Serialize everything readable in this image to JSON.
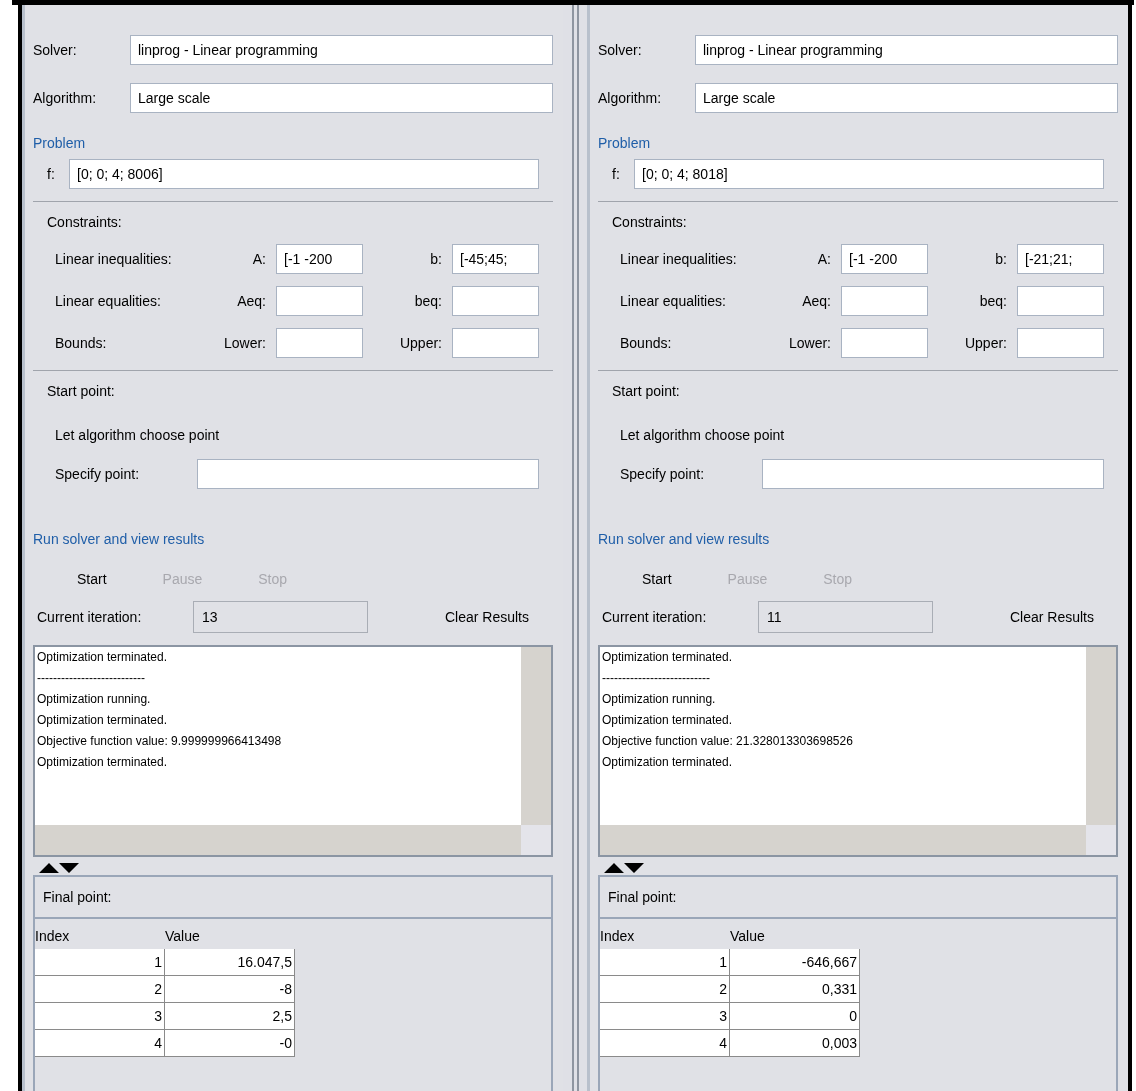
{
  "panels": [
    {
      "solver": {
        "label": "Solver:",
        "value": "linprog - Linear programming"
      },
      "algorithm": {
        "label": "Algorithm:",
        "value": "Large scale"
      },
      "problem_heading": "Problem",
      "f": {
        "label": "f:",
        "value": "[0; 0; 4; 8006]"
      },
      "constraints": {
        "title": "Constraints:",
        "rows": [
          {
            "label": "Linear inequalities:",
            "field_1_label": "A:",
            "field_1_value": "[-1 -200",
            "field_2_label": "b:",
            "field_2_value": "[-45;45;"
          },
          {
            "label": "Linear equalities:",
            "field_1_label": "Aeq:",
            "field_1_value": "",
            "field_2_label": "beq:",
            "field_2_value": ""
          },
          {
            "label": "Bounds:",
            "field_1_label": "Lower:",
            "field_1_value": "",
            "field_2_label": "Upper:",
            "field_2_value": ""
          }
        ]
      },
      "start_point": {
        "title": "Start point:",
        "option": "Let algorithm choose point",
        "specify_label": "Specify point:"
      },
      "run_heading": "Run solver and view results",
      "buttons": [
        {
          "label": "Start",
          "disabled": false
        },
        {
          "label": "Pause",
          "disabled": true
        },
        {
          "label": "Stop",
          "disabled": true
        }
      ],
      "iteration": {
        "label": "Current iteration:",
        "value": "13"
      },
      "clear_button": "Clear Results",
      "log": [
        "Optimization terminated.",
        "---------------------------",
        "Optimization running.",
        "Optimization terminated.",
        "Objective function value: 9.999999966413498",
        "Optimization terminated."
      ],
      "final_point": {
        "title": "Final point:",
        "columns": [
          "Index",
          "Value"
        ],
        "rows": [
          [
            "1",
            "16.047,5"
          ],
          [
            "2",
            "-8"
          ],
          [
            "3",
            "2,5"
          ],
          [
            "4",
            "-0"
          ]
        ]
      }
    },
    {
      "solver": {
        "label": "Solver:",
        "value": "linprog - Linear programming"
      },
      "algorithm": {
        "label": "Algorithm:",
        "value": "Large scale"
      },
      "problem_heading": "Problem",
      "f": {
        "label": "f:",
        "value": "[0; 0; 4; 8018]"
      },
      "constraints": {
        "title": "Constraints:",
        "rows": [
          {
            "label": "Linear inequalities:",
            "field_1_label": "A:",
            "field_1_value": "[-1 -200",
            "field_2_label": "b:",
            "field_2_value": "[-21;21;"
          },
          {
            "label": "Linear equalities:",
            "field_1_label": "Aeq:",
            "field_1_value": "",
            "field_2_label": "beq:",
            "field_2_value": ""
          },
          {
            "label": "Bounds:",
            "field_1_label": "Lower:",
            "field_1_value": "",
            "field_2_label": "Upper:",
            "field_2_value": ""
          }
        ]
      },
      "start_point": {
        "title": "Start point:",
        "option": "Let algorithm choose point",
        "specify_label": "Specify point:"
      },
      "run_heading": "Run solver and view results",
      "buttons": [
        {
          "label": "Start",
          "disabled": false
        },
        {
          "label": "Pause",
          "disabled": true
        },
        {
          "label": "Stop",
          "disabled": true
        }
      ],
      "iteration": {
        "label": "Current iteration:",
        "value": "11"
      },
      "clear_button": "Clear Results",
      "log": [
        "Optimization terminated.",
        "---------------------------",
        "Optimization running.",
        "Optimization terminated.",
        "Objective function value: 21.328013303698526",
        "Optimization terminated."
      ],
      "final_point": {
        "title": "Final point:",
        "columns": [
          "Index",
          "Value"
        ],
        "rows": [
          [
            "1",
            "-646,667"
          ],
          [
            "2",
            "0,331"
          ],
          [
            "3",
            "0"
          ],
          [
            "4",
            "0,003"
          ]
        ]
      }
    }
  ]
}
